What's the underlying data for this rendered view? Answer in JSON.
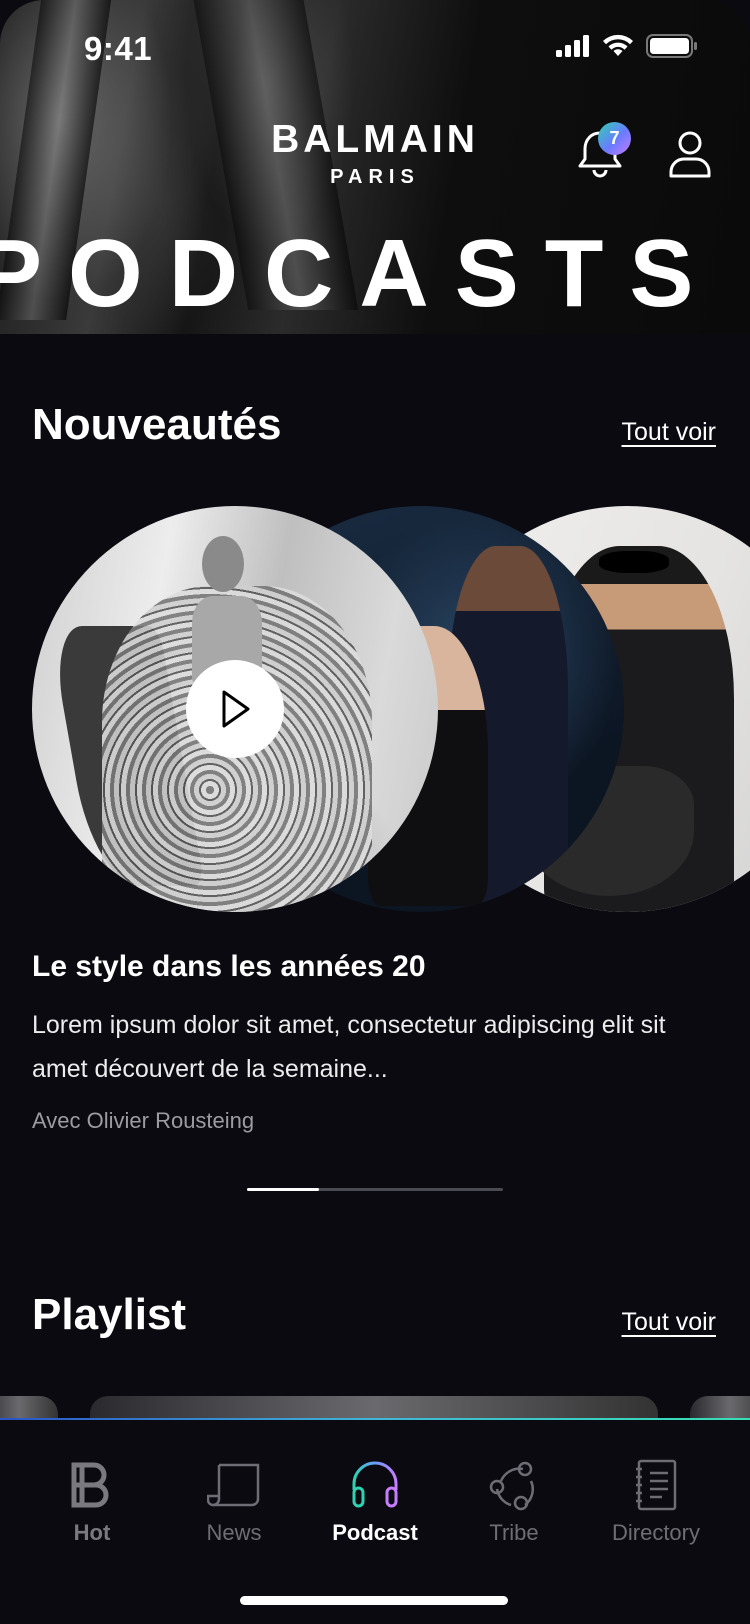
{
  "status_bar": {
    "time": "9:41"
  },
  "header": {
    "brand_name": "BALMAIN",
    "brand_sub": "PARIS",
    "notification_count": "7",
    "hero_word": "PODCASTS"
  },
  "new_section": {
    "title": "Nouveautés",
    "see_all": "Tout voir",
    "episode": {
      "title": "Le style dans les années 20",
      "description": "Lorem ipsum dolor sit amet, consectetur adipiscing elit sit amet découvert de la semaine...",
      "host": "Avec Olivier Rousteing"
    },
    "carousel_progress": 0.28
  },
  "playlist_section": {
    "title": "Playlist",
    "see_all": "Tout voir"
  },
  "tabbar": {
    "items": [
      {
        "label": "Hot",
        "icon": "balmain-b-icon"
      },
      {
        "label": "News",
        "icon": "news-icon"
      },
      {
        "label": "Podcast",
        "icon": "headphones-icon"
      },
      {
        "label": "Tribe",
        "icon": "tribe-icon"
      },
      {
        "label": "Directory",
        "icon": "directory-icon"
      }
    ],
    "active": "Podcast"
  },
  "colors": {
    "background": "#0b0a10",
    "accent_gradient_start": "#2fd2b0",
    "accent_gradient_end": "#c77dff",
    "inactive_tab": "#6e6d75"
  }
}
